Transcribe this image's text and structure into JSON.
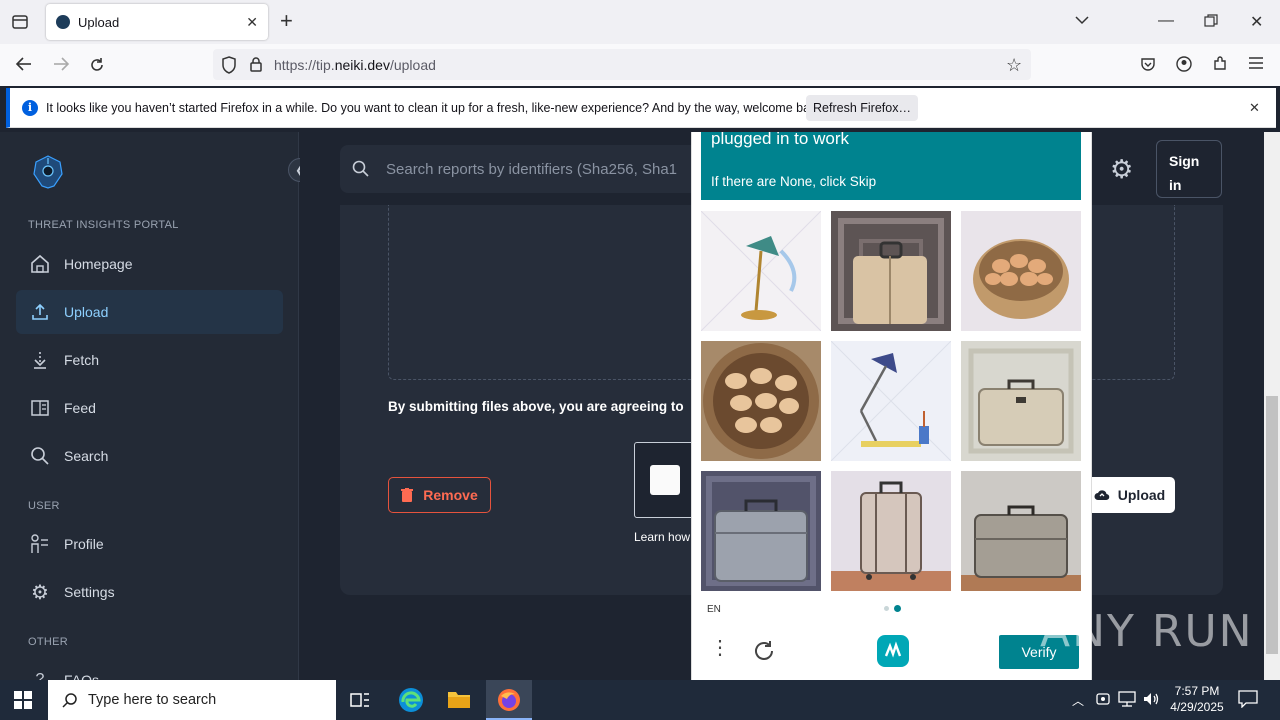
{
  "browser": {
    "tab_title": "Upload",
    "url_prefix": "https://tip.",
    "url_domain": "neiki.dev",
    "url_path": "/upload",
    "notification": "It looks like you haven’t started Firefox in a while. Do you want to clean it up for a fresh, like-new experience? And by the way, welcome back!",
    "refresh_label": "Refresh Firefox…"
  },
  "sidebar": {
    "portal_label": "THREAT INSIGHTS PORTAL",
    "items": [
      {
        "label": "Homepage",
        "icon": "home-icon"
      },
      {
        "label": "Upload",
        "icon": "upload-icon",
        "active": true
      },
      {
        "label": "Fetch",
        "icon": "download-icon"
      },
      {
        "label": "Feed",
        "icon": "feed-icon"
      },
      {
        "label": "Search",
        "icon": "search-icon"
      }
    ],
    "user_label": "USER",
    "user_items": [
      {
        "label": "Profile",
        "icon": "profile-icon"
      },
      {
        "label": "Settings",
        "icon": "gear-icon"
      }
    ],
    "other_label": "OTHER",
    "other_items": [
      {
        "label": "FAQs",
        "icon": "faq-icon"
      }
    ]
  },
  "header": {
    "search_placeholder": "Search reports by identifiers (Sha256, Sha1",
    "sign_in_line1": "Sign",
    "sign_in_line2": "in"
  },
  "upload": {
    "agree_text": "By submitting files above, you are agreeing to",
    "remove_label": "Remove",
    "upload_label": "Upload",
    "learn_text": "Learn how"
  },
  "captcha": {
    "prompt_line": "plugged in to work",
    "instruction": "If there are None, click Skip",
    "tiles": [
      "desk-lamp",
      "suitcase",
      "egg-basket",
      "egg-basket",
      "desk-lamp",
      "suitcase",
      "suitcase",
      "suitcase",
      "suitcase"
    ],
    "language": "EN",
    "verify_label": "Verify",
    "accent": "#00838f"
  },
  "watermark": "ANY RUN",
  "taskbar": {
    "search_placeholder": "Type here to search",
    "time": "7:57 PM",
    "date": "4/29/2025"
  }
}
